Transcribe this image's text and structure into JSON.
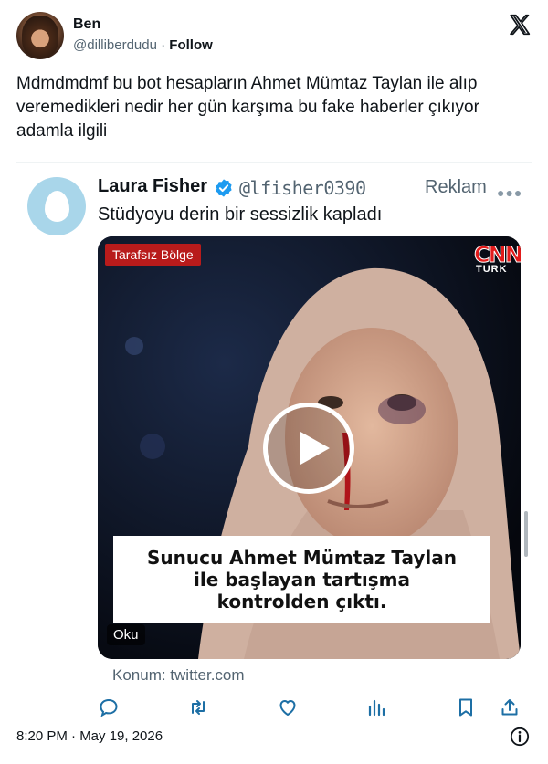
{
  "author": {
    "name": "Ben",
    "handle": "@dilliberdudu",
    "separator": " · ",
    "follow_label": "Follow"
  },
  "tweet": {
    "text": "Mdmdmdmf bu bot hesapların Ahmet Mümtaz Taylan ile alıp veremedikleri nedir her gün karşıma bu fake haberler çıkıyor adamla ilgili"
  },
  "quoted": {
    "name": "Laura Fisher",
    "handle": "@lfisher0390",
    "ad_label": "Reklam",
    "text": "Stüdyoyu derin bir sessizlik kapladı",
    "media": {
      "channel_label": "Tarafsız Bölge",
      "logo_top": "CNN",
      "logo_bottom": "TURK",
      "caption_lines": [
        "Sunucu Ahmet Mümtaz Taylan",
        "ile başlayan tartışma",
        "kontrolden çıktı."
      ],
      "read_label": "Oku"
    },
    "source": "Konum: twitter.com"
  },
  "footer": {
    "timestamp": "8:20 PM · May 19, 2026"
  },
  "icons": {
    "logo": "x-logo-icon",
    "verified": "verified-badge-icon",
    "more": "more-icon",
    "play": "play-icon",
    "reply": "reply-icon",
    "retweet": "retweet-icon",
    "like": "heart-icon",
    "views": "views-icon",
    "bookmark": "bookmark-icon",
    "share": "share-icon",
    "info": "info-icon"
  },
  "colors": {
    "text": "#0f1419",
    "secondary": "#536471",
    "verified_blue": "#1d9bf0",
    "icon_blue": "#1d6fa5",
    "channel_red": "#b81b1b"
  }
}
